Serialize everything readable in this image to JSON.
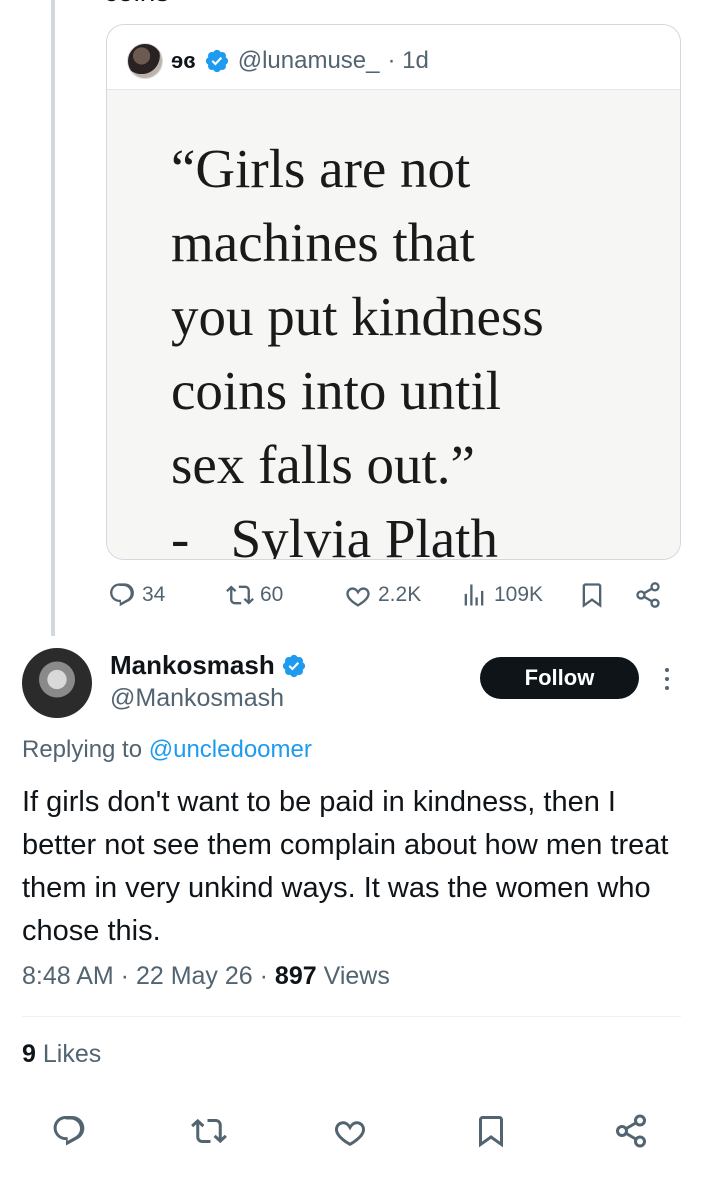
{
  "top_cut_text": "coins",
  "quoted_tweet": {
    "name": "ɘɞ",
    "handle": "@lunamuse_",
    "time": "· 1d",
    "image_text": "“Girls are not\nmachines that\nyou put kindness\ncoins into until\nsex falls out.”\n-   Sylvia Plath"
  },
  "quoted_stats": {
    "replies": "34",
    "reposts": "60",
    "likes": "2.2K",
    "views": "109K"
  },
  "tweet": {
    "name": "Mankosmash",
    "handle": "@Mankosmash",
    "follow_label": "Follow",
    "replying_prefix": "Replying to ",
    "replying_to": "@uncledoomer",
    "text": "If girls don't want to be paid in kindness, then I better not see them complain about how men treat them in very unkind ways. It was the women who chose this.",
    "time": "8:48 AM",
    "date": "22 May 26",
    "views_count": "897",
    "views_label": "Views",
    "likes_count": "9",
    "likes_label": "Likes"
  },
  "colors": {
    "accent": "#1d9bf0",
    "text_primary": "#0f1419",
    "text_secondary": "#536471",
    "border": "#cfd9de"
  },
  "icons": [
    "reply-icon",
    "repost-icon",
    "like-icon",
    "views-icon",
    "bookmark-icon",
    "share-icon",
    "verified-icon",
    "more-icon"
  ]
}
